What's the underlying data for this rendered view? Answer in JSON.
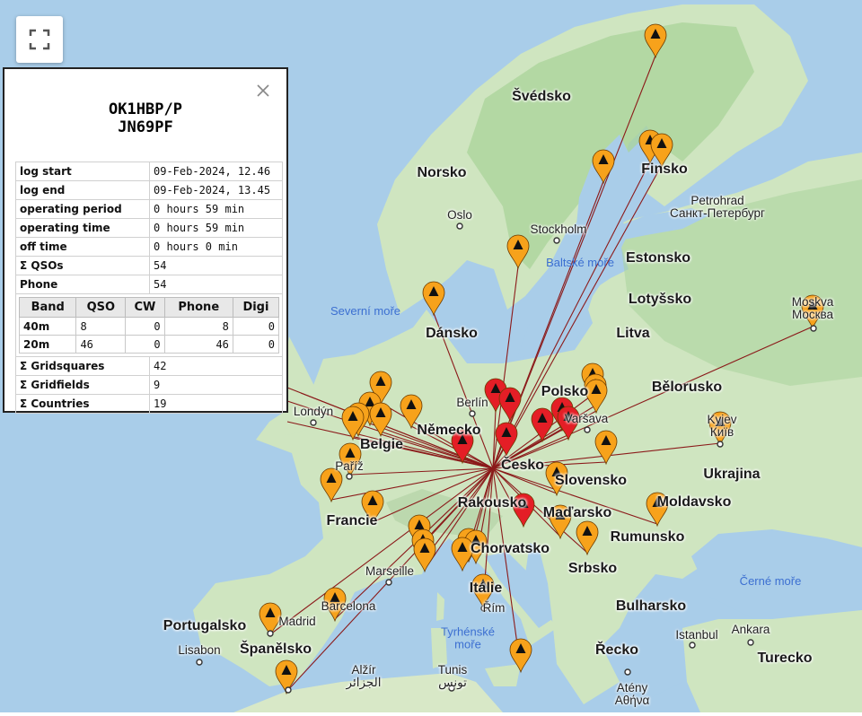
{
  "popup": {
    "callsign": "OK1HBP/P",
    "locator": "JN69PF",
    "stats": [
      {
        "key": "log start",
        "value": "09-Feb-2024, 12.46"
      },
      {
        "key": "log end",
        "value": "09-Feb-2024, 13.45"
      },
      {
        "key": "operating period",
        "value": "0 hours 59 min"
      },
      {
        "key": "operating time",
        "value": "0 hours 59 min"
      },
      {
        "key": "off time",
        "value": "0 hours 0 min"
      },
      {
        "key": "Σ QSOs",
        "value": "54"
      },
      {
        "key": "Phone",
        "value": "54"
      }
    ],
    "band_headers": [
      "Band",
      "QSO",
      "CW",
      "Phone",
      "Digi"
    ],
    "bands": [
      [
        "40m",
        "8",
        "0",
        "8",
        "0"
      ],
      [
        "20m",
        "46",
        "0",
        "46",
        "0"
      ]
    ],
    "totals": [
      {
        "key": "Σ Gridsquares",
        "value": "42"
      },
      {
        "key": "Σ Gridfields",
        "value": "9"
      },
      {
        "key": "Σ Countries",
        "value": "19"
      }
    ]
  },
  "labels": {
    "countries": [
      "Švédsko",
      "Norsko",
      "Finsko",
      "Estonsko",
      "Lotyšsko",
      "Dánsko",
      "Litva",
      "Bělorusko",
      "Polsko",
      "Německo",
      "Česko",
      "Slovensko",
      "Ukrajina",
      "Rakousko",
      "Maďarsko",
      "Moldavsko",
      "Rumunsko",
      "Francie",
      "Chorvatsko",
      "Srbsko",
      "Itálie",
      "Bulharsko",
      "Portugalsko",
      "Španělsko",
      "Řecko",
      "Turecko",
      "Belgie"
    ],
    "cities": [
      "Oslo",
      "Stockholm",
      "Petrohrad\nСанкт-Петербург",
      "Moskva\nМосква",
      "Berlín",
      "Varšava",
      "Londýn",
      "Paříž",
      "Kyjev\nКиїв",
      "Marseille",
      "Barcelona",
      "Madrid",
      "Lisabon",
      "Řím",
      "Alžír\nالجزائر",
      "Tunis\nتونس",
      "Istanbul",
      "Ankara",
      "Atény\nΑθήνα"
    ],
    "seas": [
      "Baltské moře",
      "Severní moře",
      "Černé moře",
      "Tyrhénské\nmoře"
    ]
  },
  "colors": {
    "land": "#cfe5c0",
    "forest": "#a9d39a",
    "water": "#a9cde9",
    "line": "#8b1a1a",
    "marker_orange": "#f7a21b",
    "marker_red": "#e41e26"
  },
  "icons": {
    "fullscreen": "fullscreen-icon",
    "close": "close-icon",
    "marker": "map-marker-icon"
  }
}
